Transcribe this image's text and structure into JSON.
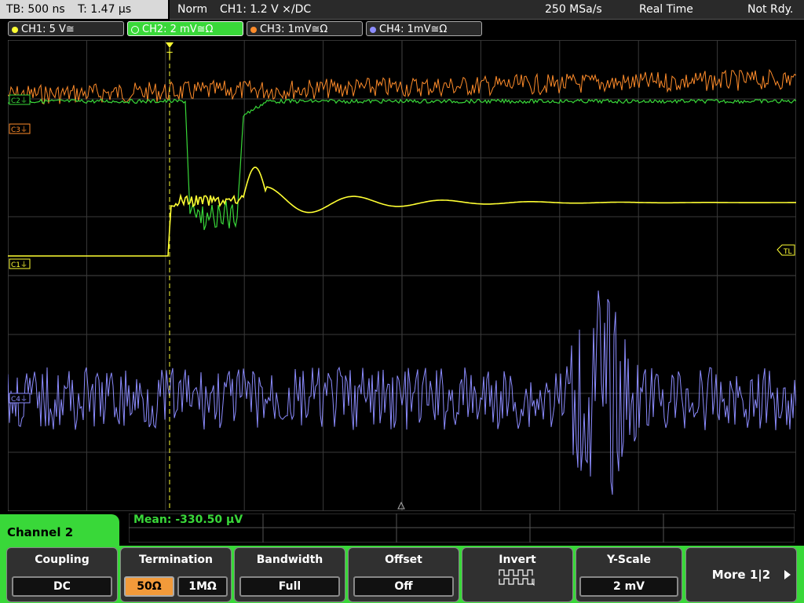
{
  "header": {
    "timebase": "TB: 500 ns",
    "trigger_time": "T: 1.47 µs",
    "mode": "Norm",
    "trigger_info": "CH1: 1.2 V ⨯/DC",
    "sample_rate": "250 MSa/s",
    "acq_mode": "Real Time",
    "status": "Not Rdy."
  },
  "channel_tabs": [
    {
      "label": "CH1: 5 V≅",
      "color": "#ffff33"
    },
    {
      "label": "CH2: 2 mV≅Ω",
      "color": "#39d839"
    },
    {
      "label": "CH3: 1mV≅Ω",
      "color": "#ff8c2a"
    },
    {
      "label": "CH4: 1mV≅Ω",
      "color": "#8c8cff"
    }
  ],
  "markers": {
    "c1": "C1⏚",
    "c2": "C2⏚",
    "c3": "C3⏚",
    "c4": "C4⏚",
    "tl": "TL",
    "trigger": "T"
  },
  "measurement": {
    "label": "Mean: -330.50 µV"
  },
  "menu": {
    "channel_name": "Channel 2",
    "coupling_label": "Coupling",
    "coupling_value": "DC",
    "termination_label": "Termination",
    "termination_options": [
      "50Ω",
      "1MΩ"
    ],
    "termination_selected": "50Ω",
    "bandwidth_label": "Bandwidth",
    "bandwidth_value": "Full",
    "offset_label": "Offset",
    "offset_value": "Off",
    "invert_label": "Invert",
    "yscale_label": "Y-Scale",
    "yscale_value": "2 mV",
    "more_label": "More 1|2"
  },
  "colors": {
    "ch1": "#ffff33",
    "ch2": "#39d839",
    "ch3": "#ff8c2a",
    "ch4": "#8c8cff",
    "grid": "#3a3a3a",
    "accent": "#39d839"
  }
}
